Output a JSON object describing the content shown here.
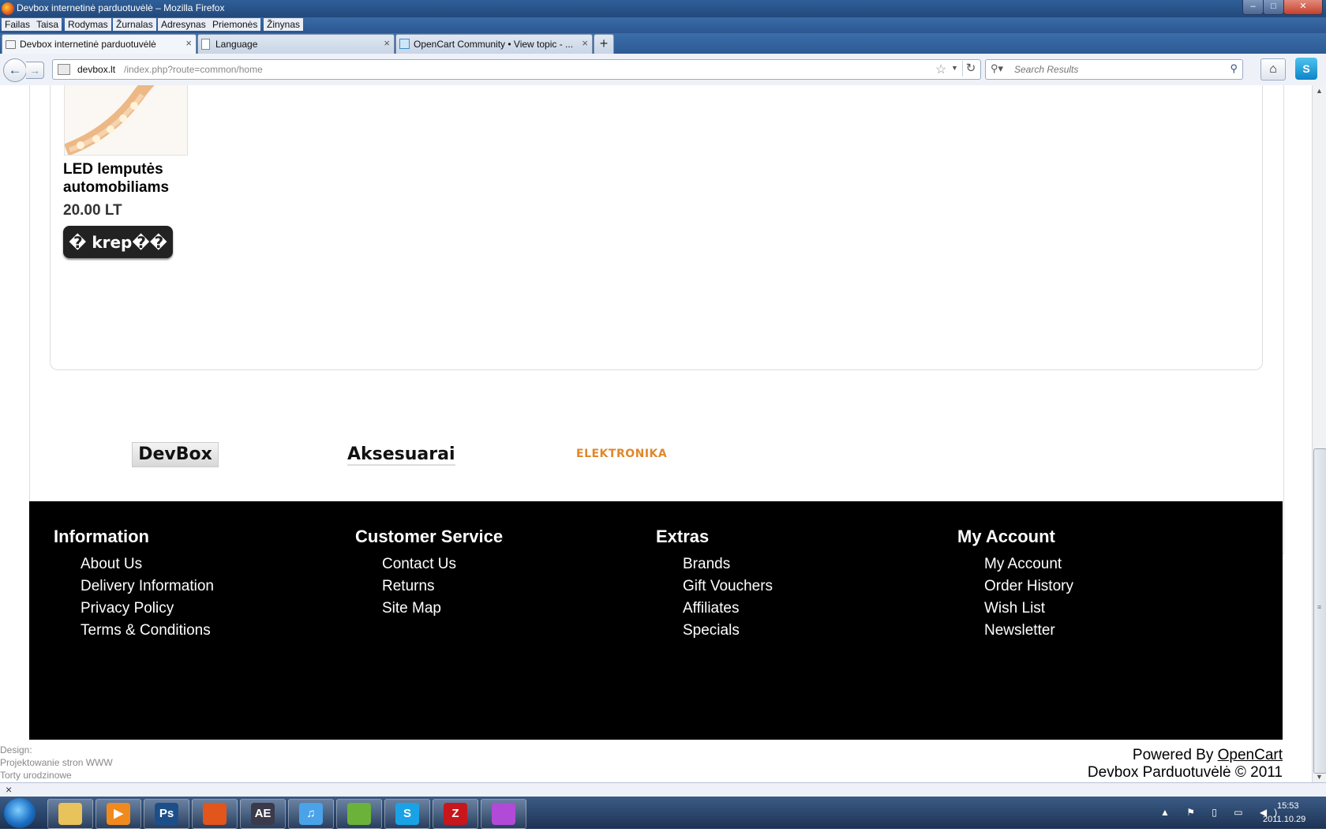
{
  "window": {
    "title": "Devbox internetinė parduotuvėlė – Mozilla Firefox",
    "controls": {
      "minimize": "‒",
      "maximize": "□",
      "close": "✕"
    }
  },
  "menu": [
    "Failas",
    "Taisa",
    "Rodymas",
    "Žurnalas",
    "Adresynas",
    "Priemonės",
    "Žinynas"
  ],
  "tabs": [
    {
      "label": "Devbox internetinė parduotuvėlė",
      "icon": "cart-icon"
    },
    {
      "label": "Language",
      "icon": "blank-page-icon"
    },
    {
      "label": "OpenCart Community • View topic - ...",
      "icon": "opencart-icon"
    }
  ],
  "tab_close_glyph": "×",
  "new_tab_glyph": "+",
  "nav": {
    "back_glyph": "←",
    "forward_glyph": "→",
    "url_host": "devbox.lt",
    "url_path": "/index.php?route=common/home",
    "search_placeholder": "Search Results"
  },
  "product": {
    "name": "LED lemputės automobiliams",
    "price": "20.00 LT",
    "button_label": "� krep��"
  },
  "brands": [
    "DevBox",
    "Aksesuarai",
    "ELEKTRONIKA"
  ],
  "footer": {
    "information": {
      "title": "Information",
      "links": [
        "About Us",
        "Delivery Information",
        "Privacy Policy",
        "Terms & Conditions"
      ]
    },
    "customer_service": {
      "title": "Customer Service",
      "links": [
        "Contact Us",
        "Returns",
        "Site Map"
      ]
    },
    "extras": {
      "title": "Extras",
      "links": [
        "Brands",
        "Gift Vouchers",
        "Affiliates",
        "Specials"
      ]
    },
    "my_account": {
      "title": "My Account",
      "links": [
        "My Account",
        "Order History",
        "Wish List",
        "Newsletter"
      ]
    }
  },
  "design_credit": {
    "label": "Design:",
    "link1": "Projektowanie stron WWW",
    "link2": "Torty urodzinowe"
  },
  "powered": {
    "prefix": "Powered By ",
    "link": "OpenCart",
    "store": "Devbox Parduotuvėlė © 2011"
  },
  "statusbar": {
    "close_glyph": "×"
  },
  "taskbar": {
    "apps": [
      {
        "name": "explorer-icon",
        "label": "",
        "color": "#e8c25a"
      },
      {
        "name": "media-player-icon",
        "label": "▶",
        "color": "#f08a1c"
      },
      {
        "name": "photoshop-icon",
        "label": "Ps",
        "color": "#1c4f8a"
      },
      {
        "name": "firefox-icon",
        "label": "",
        "color": "#e2551b"
      },
      {
        "name": "after-effects-icon",
        "label": "AE",
        "color": "#3a3a4a"
      },
      {
        "name": "itunes-icon",
        "label": "♫",
        "color": "#4aa3e8"
      },
      {
        "name": "frog-app-icon",
        "label": "",
        "color": "#6bb23a"
      },
      {
        "name": "skype-icon",
        "label": "S",
        "color": "#19a3e6"
      },
      {
        "name": "filezilla-icon",
        "label": "Z",
        "color": "#c8161d"
      },
      {
        "name": "notes-app-icon",
        "label": "",
        "color": "#b24ad8"
      }
    ],
    "tray_icons": "▲ ⚑ ▯ ▭ ◀)",
    "time": "15:53",
    "date": "2011.10.29"
  }
}
